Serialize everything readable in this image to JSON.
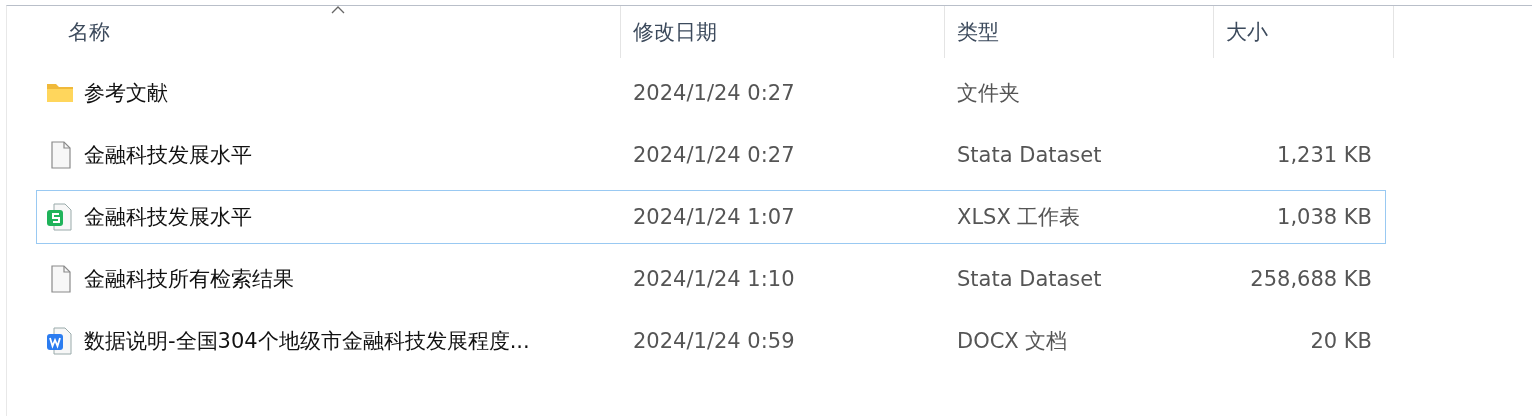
{
  "columns": [
    {
      "label": "名称",
      "sorted": true
    },
    {
      "label": "修改日期",
      "sorted": false
    },
    {
      "label": "类型",
      "sorted": false
    },
    {
      "label": "大小",
      "sorted": false
    }
  ],
  "rows": [
    {
      "kind": "folder",
      "name": "参考文献",
      "date": "2024/1/24 0:27",
      "type": "文件夹",
      "selected": false
    },
    {
      "kind": "file",
      "name": "金融科技发展水平",
      "date": "2024/1/24 0:27",
      "type": "Stata Dataset",
      "size": "1,231 KB",
      "selected": false
    },
    {
      "kind": "sheet",
      "name": "金融科技发展水平",
      "date": "2024/1/24 1:07",
      "type": "XLSX 工作表",
      "size": "1,038 KB",
      "selected": true
    },
    {
      "kind": "file",
      "name": "金融科技所有检索结果",
      "date": "2024/1/24 1:10",
      "type": "Stata Dataset",
      "size": "258,688 KB",
      "selected": false
    },
    {
      "kind": "doc",
      "name": "数据说明-全国304个地级市金融科技发展程度...",
      "date": "2024/1/24 0:59",
      "type": "DOCX 文档",
      "size": "20 KB",
      "selected": false
    }
  ]
}
